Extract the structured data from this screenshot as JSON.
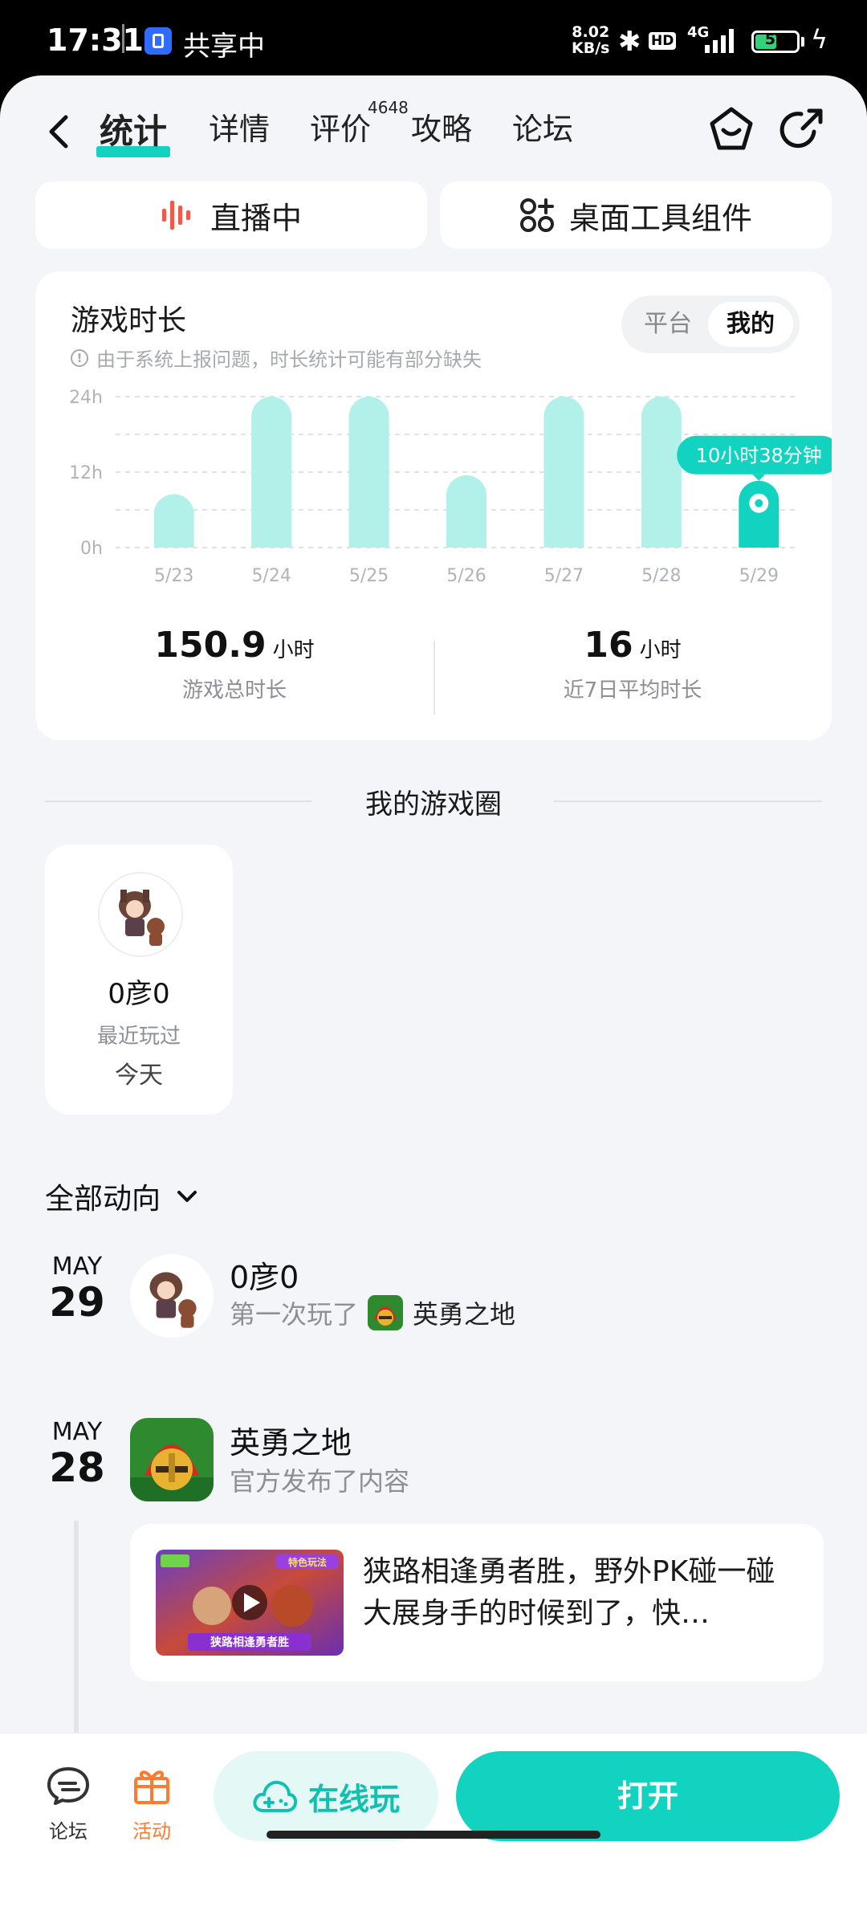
{
  "status_bar": {
    "time": "17:31",
    "share_label": "共享中",
    "speed_value": "8.02",
    "speed_unit": "KB/s",
    "hd": "HD",
    "network": "4G",
    "battery": "51"
  },
  "nav": {
    "tabs": [
      {
        "label": "统计",
        "active": true
      },
      {
        "label": "详情"
      },
      {
        "label": "评价",
        "badge": "4648"
      },
      {
        "label": "攻略"
      },
      {
        "label": "论坛"
      }
    ]
  },
  "quick_actions": {
    "live": "直播中",
    "widget": "桌面工具组件"
  },
  "playtime": {
    "title": "游戏时长",
    "notice": "由于系统上报问题，时长统计可能有部分缺失",
    "segments": [
      "平台",
      "我的"
    ],
    "active_segment": "我的",
    "total_value": "150.9",
    "total_unit": "小时",
    "total_label": "游戏总时长",
    "avg_value": "16",
    "avg_unit": "小时",
    "avg_label": "近7日平均时长"
  },
  "chart_data": {
    "type": "bar",
    "categories": [
      "5/23",
      "5/24",
      "5/25",
      "5/26",
      "5/27",
      "5/28",
      "5/29"
    ],
    "values": [
      8.5,
      24,
      24,
      11.5,
      24,
      24,
      10.63
    ],
    "y_ticks": [
      "0h",
      "12h",
      "24h"
    ],
    "ylim": [
      0,
      24
    ],
    "highlight_index": 6,
    "highlight_label": "10小时38分钟",
    "bar_color": "#b2f0ea",
    "highlight_color": "#11d3c0",
    "grid": "dashed"
  },
  "circle": {
    "title": "我的游戏圈",
    "friends": [
      {
        "name": "0彦0",
        "last_label": "最近玩过",
        "when": "今天"
      }
    ]
  },
  "feed": {
    "filter_label": "全部动向",
    "items": [
      {
        "month": "MAY",
        "day": "29",
        "title": "0彦0",
        "action": "第一次玩了",
        "game": "英勇之地"
      },
      {
        "month": "MAY",
        "day": "28",
        "title": "英勇之地",
        "action": "官方发布了内容"
      }
    ],
    "post": {
      "text": "狭路相逢勇者胜，野外PK碰一碰 大展身手的时候到了，快…",
      "thumb_badge": "特色玩法",
      "thumb_caption": "狭路相逢勇者胜"
    }
  },
  "bottom_bar": {
    "forum": "论坛",
    "activity": "活动",
    "online": "在线玩",
    "open": "打开"
  },
  "colors": {
    "accent": "#11d3c0",
    "activity": "#ff7a2f"
  }
}
